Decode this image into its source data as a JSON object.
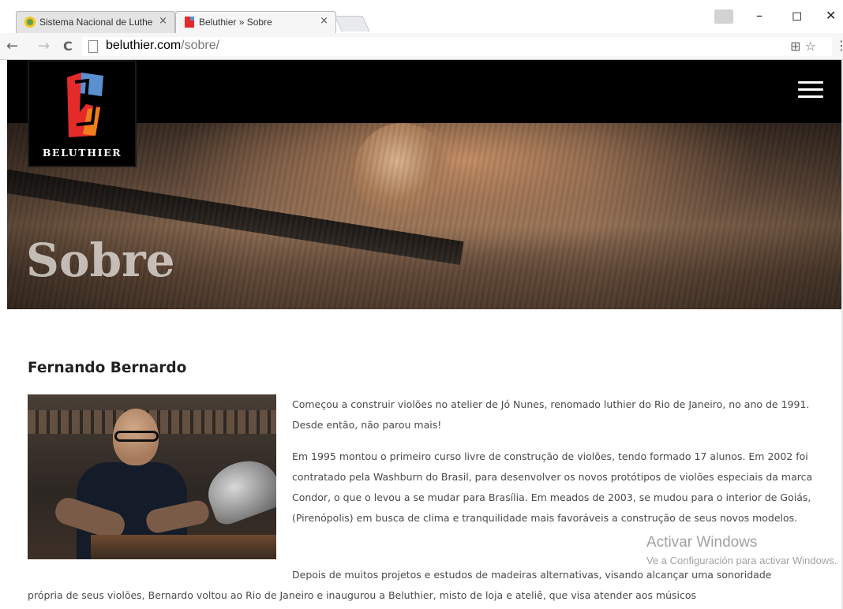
{
  "browser": {
    "tabs": [
      {
        "title": "Sistema Nacional de Luthe",
        "close": "×",
        "active": false
      },
      {
        "title": "Beluthier » Sobre",
        "close": "×",
        "active": true
      }
    ],
    "window_controls": {
      "minimize": "–",
      "maximize": "◻",
      "close": "✕"
    },
    "nav": {
      "back": "←",
      "forward": "→",
      "reload": "C"
    },
    "url": {
      "host": "beluthier.com",
      "path": "/sobre/"
    },
    "omnibox_icons": {
      "translate": "⊞",
      "star": "☆"
    },
    "menu": "⋮"
  },
  "site": {
    "logo_text": "BELUTHIER",
    "brand_colors": {
      "red": "#e52a2a",
      "blue": "#5a8fd0",
      "orange": "#f07d1b",
      "dark": "#000000"
    },
    "hero_title": "Sobre"
  },
  "content": {
    "name": "Fernando Bernardo",
    "p1": "Começou a construir violões no atelier de Jó Nunes, renomado luthier do Rio de Janeiro, no ano de 1991. Desde então, não parou mais!",
    "p2": "Em 1995 montou o primeiro curso livre de construção de violões, tendo formado 17 alunos. Em 2002 foi contratado pela Washburn do Brasil, para desenvolver os novos protótipos de violões especiais da marca Condor, o que o levou a se mudar para Brasília. Em meados de 2003, se mudou para o interior de Goiás, (Pirenópolis) em busca de clima e tranquilidade mais favoráveis a construção de seus novos modelos.",
    "p3_first": "Depois de muitos projetos e estudos de madeiras alternativas, visando alcançar uma sonoridade",
    "p3_rest": "própria de seus violões, Bernardo voltou ao Rio de Janeiro e inaugurou a Beluthier, misto de loja e ateliê, que visa atender aos músicos"
  },
  "watermark": {
    "line1": "Activar Windows",
    "line2": "Ve a Configuración para activar Windows."
  }
}
